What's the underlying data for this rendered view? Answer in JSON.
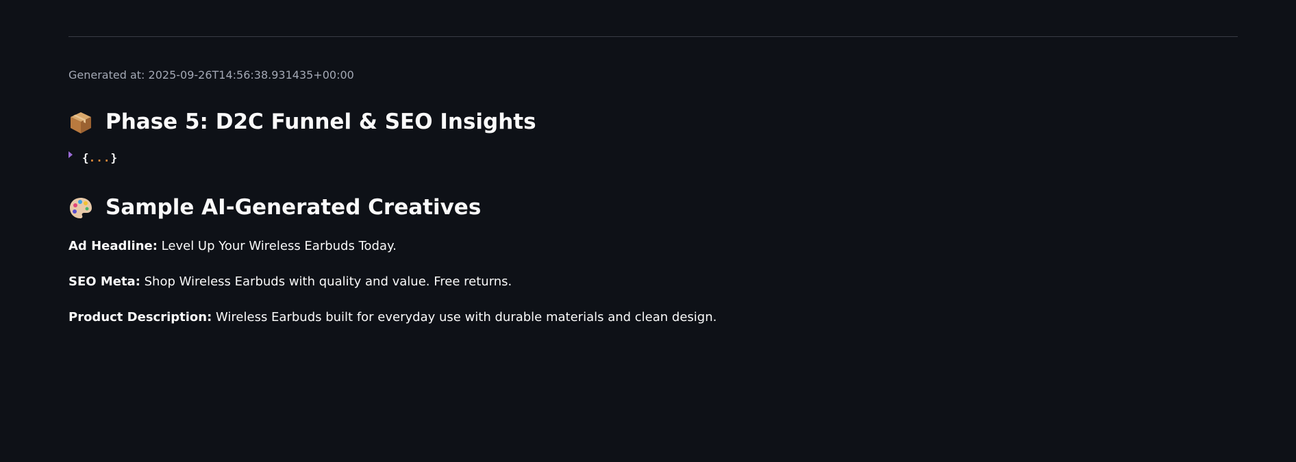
{
  "caption": "Generated at: 2025-09-26T14:56:38.931435+00:00",
  "phase_section": {
    "icon": "package-icon",
    "title": "Phase 5: D2C Funnel & SEO Insights"
  },
  "json_viewer": {
    "open_brace": "{",
    "dots": "...",
    "close_brace": "}",
    "caret_color": "#9b6bd6",
    "dots_color": "#e08a3a"
  },
  "creatives_section": {
    "icon": "artist-palette-icon",
    "title": "Sample AI-Generated Creatives"
  },
  "creatives": [
    {
      "label": "Ad Headline:",
      "value": " Level Up Your Wireless Earbuds Today."
    },
    {
      "label": "SEO Meta:",
      "value": " Shop Wireless Earbuds with quality and value. Free returns."
    },
    {
      "label": "Product Description:",
      "value": " Wireless Earbuds built for everyday use with durable materials and clean design."
    }
  ],
  "colors": {
    "background": "#0e1117",
    "text": "#fafafa",
    "caption": "#a3a8b4",
    "divider": "#3a3d45"
  }
}
